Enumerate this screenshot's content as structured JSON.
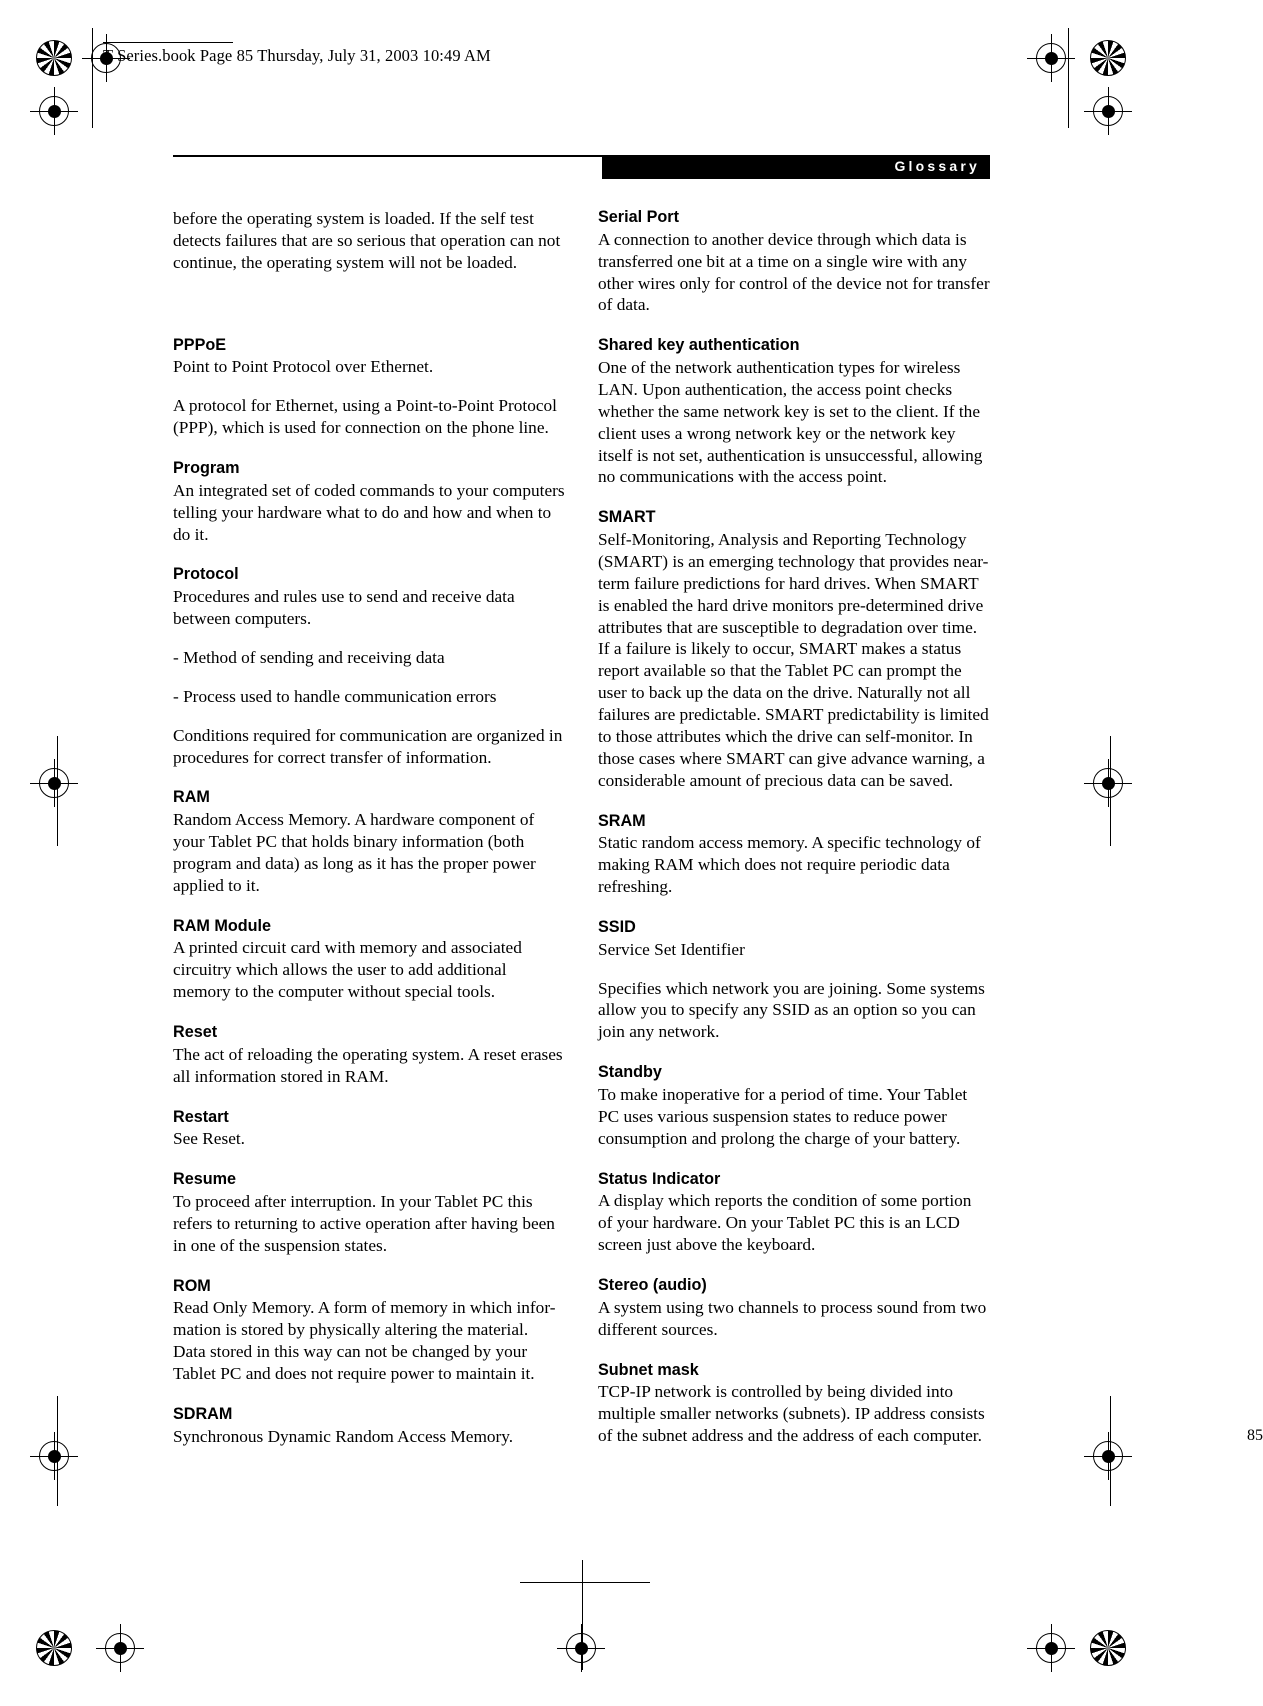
{
  "document": {
    "file_stamp": "T Series.book  Page 85  Thursday, July 31, 2003  10:49 AM",
    "header_title": "Glossary",
    "page_number": "85"
  },
  "left_column": {
    "continued_paragraph": "before the operating system is loaded. If the self test detects failures that are so serious that operation can not continue, the operating system will not be loaded.",
    "entries": [
      {
        "term": "PPPoE",
        "paragraphs": [
          "Point to Point Protocol over Ethernet.",
          "A protocol for Ethernet, using a Point-to-Point Protocol (PPP), which is used for connection on the phone line."
        ]
      },
      {
        "term": "Program",
        "paragraphs": [
          "An integrated set of coded commands to your computers telling your hardware what to do and how and when to do it."
        ]
      },
      {
        "term": "Protocol",
        "paragraphs": [
          "Procedures and rules use to send and receive data between computers.",
          "- Method of sending and receiving data",
          "- Process used to handle communication errors",
          "Conditions required for communication are organized in procedures for correct transfer of information."
        ]
      },
      {
        "term": "RAM",
        "paragraphs": [
          "Random Access Memory. A hardware component of your Tablet PC that holds binary information (both program and data) as long as it has the proper power applied to it."
        ]
      },
      {
        "term": "RAM Module",
        "paragraphs": [
          "A printed circuit card with memory and associated circuitry which allows the user to add additional memory to the computer without special tools."
        ]
      },
      {
        "term": "Reset",
        "paragraphs": [
          "The act of reloading the operating system. A reset erases all information stored in RAM."
        ]
      },
      {
        "term": "Restart",
        "paragraphs": [
          "See Reset."
        ]
      },
      {
        "term": "Resume",
        "paragraphs": [
          "To proceed after interruption. In your Tablet PC this refers to returning to active operation after having been in one of the suspension states."
        ]
      },
      {
        "term": "ROM",
        "paragraphs": [
          "Read Only Memory. A form of memory in which infor-mation is stored by physically altering the material. Data stored in this way can not be changed by your Tablet PC and does not require power to maintain it."
        ]
      },
      {
        "term": "SDRAM",
        "paragraphs": [
          "Synchronous Dynamic Random Access Memory."
        ]
      }
    ]
  },
  "right_column": {
    "entries": [
      {
        "term": "Serial Port",
        "paragraphs": [
          "A connection to another device through which data is transferred one bit at a time on a single wire with any other wires only for control of the device not for transfer of data."
        ]
      },
      {
        "term": "Shared key authentication",
        "paragraphs": [
          "One of the network authentication types for wireless LAN. Upon authentication, the access point checks whether the same network key is set to the client. If the client uses a wrong network key or the network key itself is not set, authentication is unsuccessful, allowing no communications with the access point."
        ]
      },
      {
        "term": "SMART",
        "paragraphs": [
          "Self-Monitoring, Analysis and Reporting Technology (SMART) is an emerging technology that provides near-term failure predictions for hard drives. When SMART is enabled the hard drive monitors pre-determined drive attributes that are susceptible to degradation over time. If a failure is likely to occur, SMART makes a status report available so that the Tablet PC can prompt the user to back up the data on the drive. Naturally not all failures are predictable. SMART predictability is limited to those attributes which the drive can self-monitor. In those cases where SMART can give advance warning, a considerable amount of precious data can be saved."
        ]
      },
      {
        "term": "SRAM",
        "paragraphs": [
          "Static random access memory. A specific technology of making RAM which does not require periodic data refreshing."
        ]
      },
      {
        "term": "SSID",
        "paragraphs": [
          "Service Set Identifier",
          "Specifies which network you are joining. Some systems allow you to specify any SSID as an option so you can join any network."
        ]
      },
      {
        "term": "Standby",
        "paragraphs": [
          "To make inoperative for a period of time. Your Tablet PC uses various suspension states to reduce power consumption and prolong the charge of your battery."
        ]
      },
      {
        "term": "Status Indicator",
        "paragraphs": [
          "A display which reports the condition of some portion of your hardware. On your Tablet PC this is an LCD screen just above the keyboard."
        ]
      },
      {
        "term": "Stereo (audio)",
        "paragraphs": [
          "A system using two channels to process sound from two different sources."
        ]
      },
      {
        "term": "Subnet mask",
        "paragraphs": [
          "TCP-IP network is controlled by being divided into multiple smaller networks (subnets). IP address consists of the subnet address and the address of each computer."
        ]
      }
    ]
  }
}
